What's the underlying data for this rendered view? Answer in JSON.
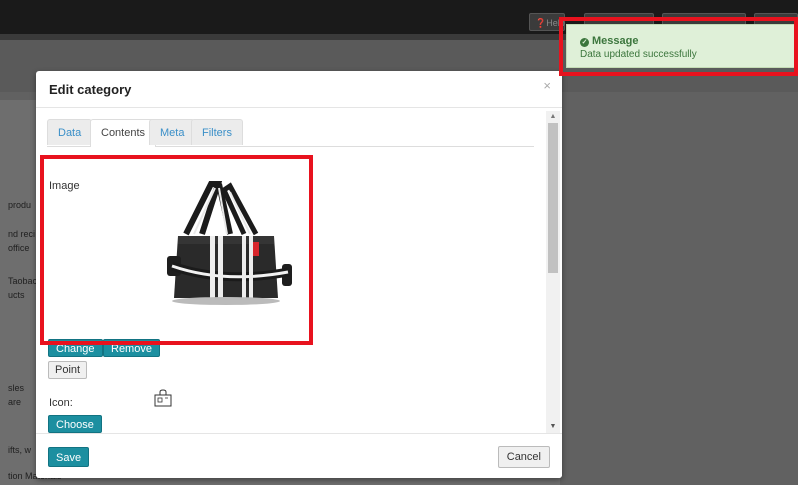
{
  "background": {
    "topbar_buttons": [
      "Help"
    ],
    "sidebar_fragments": [
      "produ",
      "nd reci",
      "office",
      "Taobac",
      "ucts",
      "sles",
      "are",
      "ifts, w",
      "tion Materials"
    ]
  },
  "notification": {
    "title": "Message",
    "text": "Data updated successfully",
    "color": "#3c763d",
    "icon": "check-circle-icon"
  },
  "modal": {
    "title": "Edit category",
    "close_glyph": "×",
    "tabs": [
      {
        "label": "Data",
        "active": false
      },
      {
        "label": "Contents",
        "active": true
      },
      {
        "label": "Meta",
        "active": false
      },
      {
        "label": "Filters",
        "active": false
      }
    ],
    "image_section": {
      "label": "Image",
      "change_label": "Change",
      "remove_label": "Remove",
      "point_label": "Point"
    },
    "icon_section": {
      "label": "Icon:",
      "icon": "shopping-bag-icon",
      "choose_label": "Choose"
    },
    "footer": {
      "save_label": "Save",
      "cancel_label": "Cancel"
    },
    "accent_color": "#1c8fa0",
    "highlight_color": "#e8121e"
  }
}
